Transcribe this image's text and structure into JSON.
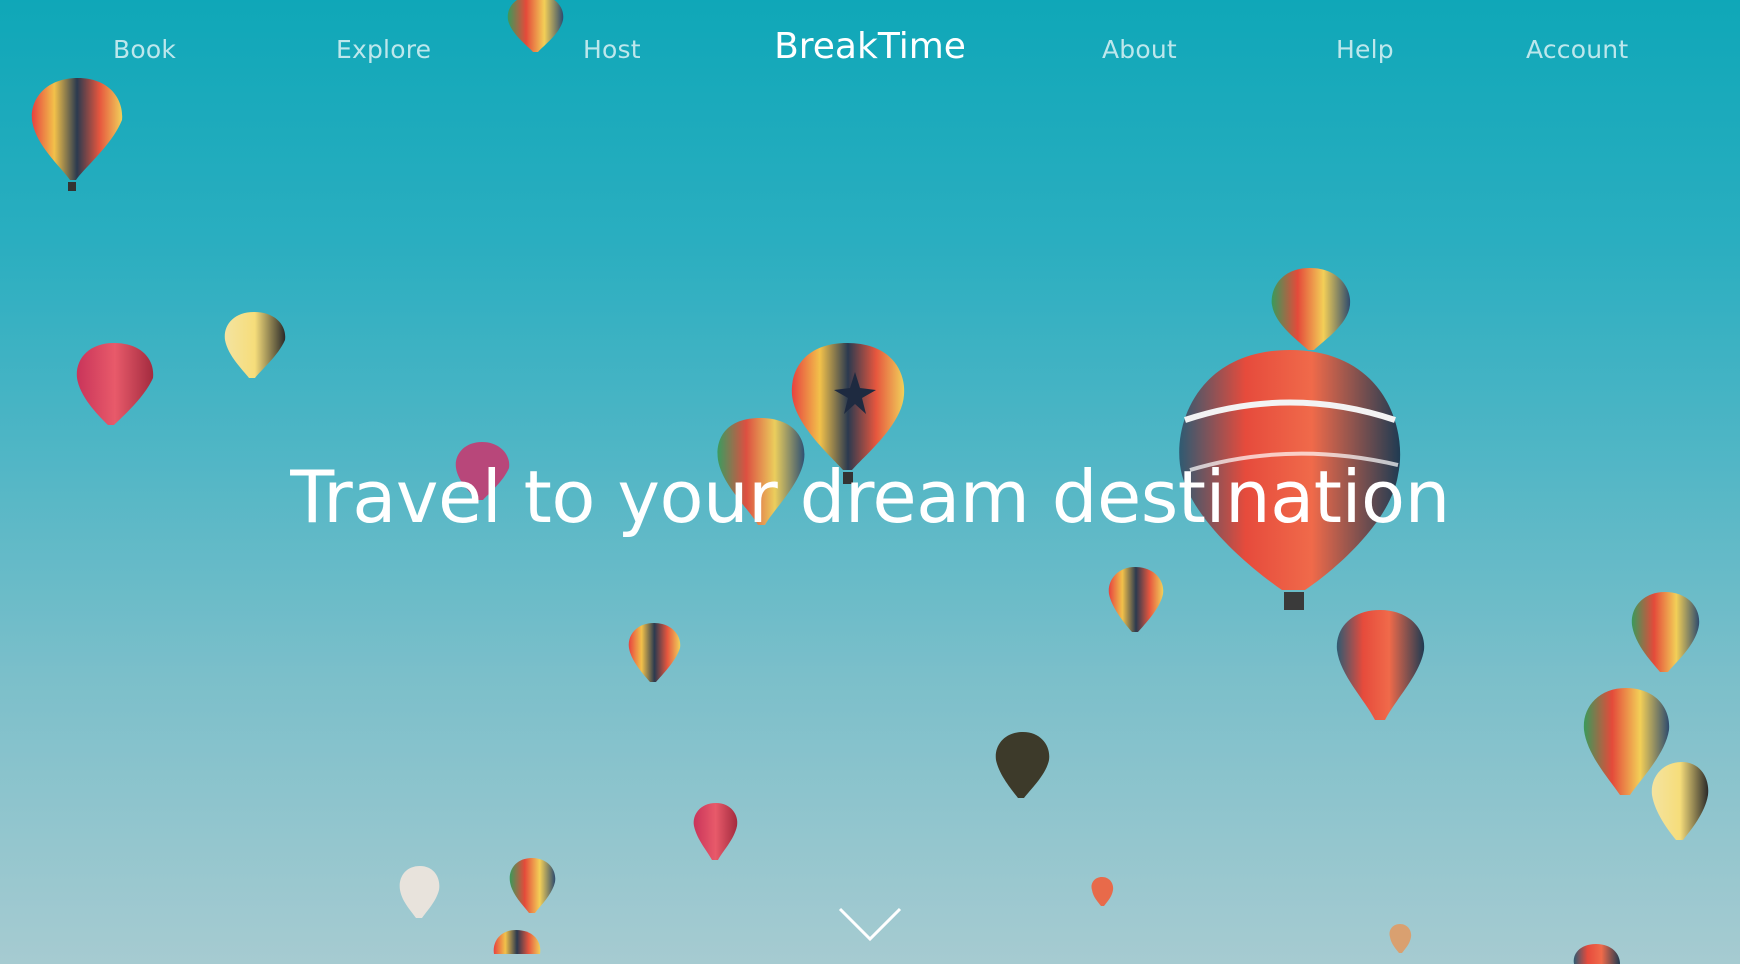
{
  "nav": {
    "left": [
      {
        "label": "Book"
      },
      {
        "label": "Explore"
      },
      {
        "label": "Host"
      }
    ],
    "brand": "BreakTime",
    "right": [
      {
        "label": "About"
      },
      {
        "label": "Help"
      },
      {
        "label": "Account"
      }
    ]
  },
  "hero": {
    "headline": "Travel to your dream destination",
    "scroll_icon": "chevron-down-icon",
    "background_image": "hot-air-balloons-over-blue-sky"
  },
  "colors": {
    "sky_top": "#0fa7b8",
    "sky_bottom": "#a6cbd1",
    "text": "#ffffff"
  }
}
